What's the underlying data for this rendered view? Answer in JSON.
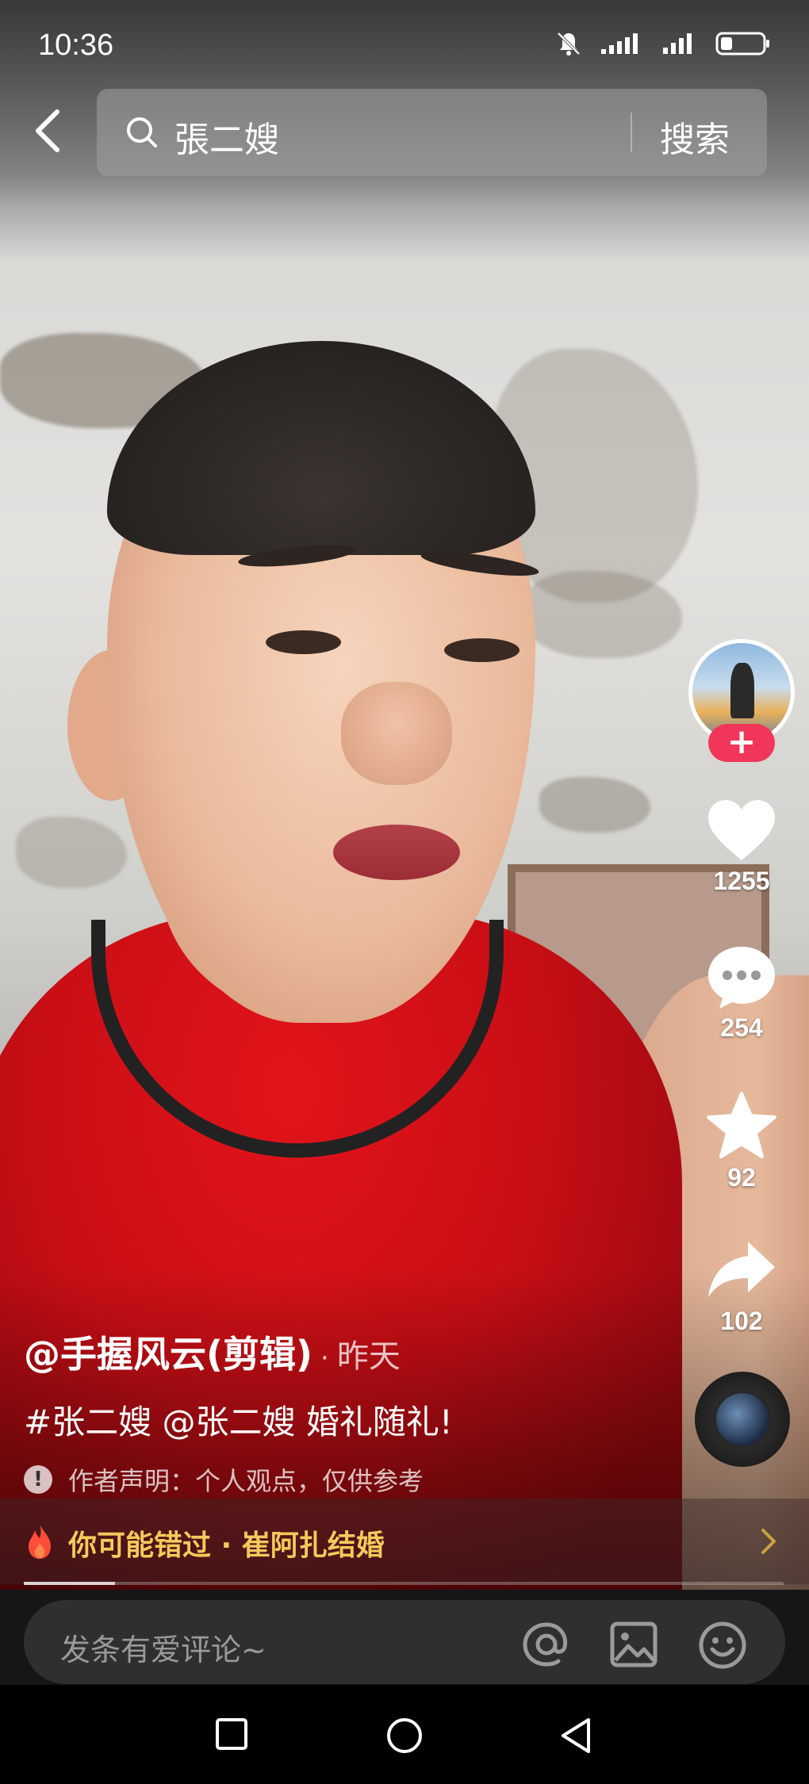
{
  "status_bar": {
    "time": "10:36",
    "icons": [
      "mute-bell-icon",
      "signal-icon",
      "signal-icon",
      "battery-icon"
    ]
  },
  "search": {
    "query": "張二嫂",
    "button_label": "搜索"
  },
  "actions": {
    "likes": "1255",
    "comments": "254",
    "favorites": "92",
    "shares": "102",
    "follow_label": "+"
  },
  "caption": {
    "author": "@手握风云(剪辑)",
    "separator": "·",
    "posted": "昨天",
    "description": "#张二嫂 @张二嫂 婚礼随礼!",
    "disclaimer_icon": "!",
    "disclaimer": "作者声明：个人观点，仅供参考"
  },
  "related": {
    "text": "你可能错过 · 崔阿扎结婚"
  },
  "progress": {
    "fraction": 0.12
  },
  "comment": {
    "placeholder": "发条有爱评论~"
  },
  "colors": {
    "follow": "#f2365b",
    "related_text": "#f5c95b"
  }
}
